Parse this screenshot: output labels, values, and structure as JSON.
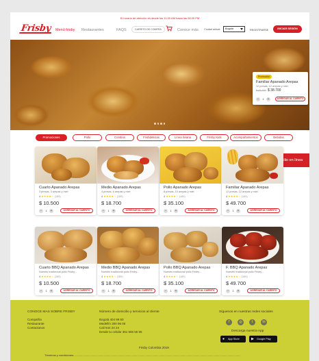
{
  "header": {
    "hours_notice": "El horario de atención es desde las 11:00 AM hasta las 08:00 PM",
    "logo": "Frisby",
    "nav": [
      "Menú frisby",
      "Restaurantes",
      "FAQS"
    ],
    "cart_label": "CARRITO DE COMPRA",
    "know_more": "Conoce más",
    "city_label": "Ciudad actual:",
    "city_value": "Bogotá",
    "register_label": "REGISTRARSE",
    "login_label": "INICIAR SESIÓN"
  },
  "hero": {
    "promo_badge": "Promoción",
    "promo_title": "Familiar Apanado Arepas",
    "promo_desc": "12 presas, 12 arepas y miel",
    "promo_old_price": "$ 45.700",
    "promo_price": "$ 38.700",
    "promo_qty": "1",
    "promo_add_label": "AGREGAR AL CARRITO"
  },
  "categories": [
    "Promociones",
    "Pollo",
    "Combos",
    "Frisbdelicias",
    "Línea liviana",
    "Frisby Kids",
    "Acompañamientos",
    "Bebidas"
  ],
  "delivery_label": "Domicilio en línea",
  "products": [
    {
      "title": "Cuarto Apanado Arepas",
      "desc": "3 presas, 3 arepas y miel",
      "rating": "4",
      "stars": "★★★★☆",
      "count": "(189)",
      "price": "$ 10.500",
      "qty": "1",
      "add": "AGREGAR AL CARRITO"
    },
    {
      "title": "Medio Apanado Arepas",
      "desc": "4 presas, 6 arepas y miel",
      "rating": "4",
      "stars": "★★★★☆",
      "count": "(189)",
      "price": "$ 18.700",
      "qty": "1",
      "add": "AGREGAR AL CARRITO"
    },
    {
      "title": "Pollo Apanado Arepas",
      "desc": "8 presas, 10 arepas y miel",
      "rating": "4",
      "stars": "★★★★☆",
      "count": "(189)",
      "price": "$ 35.100",
      "qty": "1",
      "add": "AGREGAR AL CARRITO"
    },
    {
      "title": "Familiar Apanado Arepas",
      "desc": "12 presas, 12 arepas y miel",
      "rating": "4",
      "stars": "★★★★☆",
      "count": "(189)",
      "price": "$ 49.700",
      "qty": "1",
      "add": "AGREGAR AL CARRITO"
    },
    {
      "title": "Cuarto BBQ Apanado Arepas",
      "desc": "Nuestro tradicional pollo Frisby...",
      "rating": "4",
      "stars": "★★★★☆",
      "count": "(189)",
      "price": "$ 10.500",
      "qty": "1",
      "add": "AGREGAR AL CARRITO"
    },
    {
      "title": "Medio BBQ Apanado Arepas",
      "desc": "Nuestro tradicional pollo Frisby...",
      "rating": "4",
      "stars": "★★★★☆",
      "count": "(189)",
      "price": "$ 18.700",
      "qty": "1",
      "add": "AGREGAR AL CARRITO"
    },
    {
      "title": "Pollo BBQ Apanado Arepas",
      "desc": "Nuestro tradicional pollo Frisby...",
      "rating": "4",
      "stars": "★★★★☆",
      "count": "(189)",
      "price": "$ 35.100",
      "qty": "1",
      "add": "AGREGAR AL CARRITO"
    },
    {
      "title": "F. BBQ Apanado Arepas",
      "desc": "Nuestro tradicional pollo Frisby...",
      "rating": "4",
      "stars": "★★★★☆",
      "count": "(189)",
      "price": "$ 49.700",
      "qty": "1",
      "add": "AGREGAR AL CARRITO"
    }
  ],
  "footer": {
    "about_title": "CONOCE MAS SOBRE FRISBY",
    "about_links": [
      "Compañía",
      "Restaurante",
      "Contactanos"
    ],
    "phones_title": "Número de domicilio y servicios al cliente",
    "phones": [
      "Bogotá 404 99 50",
      "Medellín 300 96 00",
      "Cali 644 24 24",
      "Desde tu celular 361 555 55 55"
    ],
    "social_title": "Síguenos en nuestras redes sociales",
    "social_icons": [
      "facebook-icon",
      "instagram-icon",
      "twitter-icon",
      "linkedin-icon"
    ],
    "download_label": "Descarga nuestra App",
    "app_store": "App Store",
    "google_play": "Google Play",
    "copyright": "Frisby Colombia 2019",
    "terms": "Términos y condiciones: .........................................................................................................................................................................................................................."
  },
  "colors": {
    "brand_red": "#d62027",
    "footer_lime": "#cdd034",
    "badge_yellow": "#f2c500"
  }
}
